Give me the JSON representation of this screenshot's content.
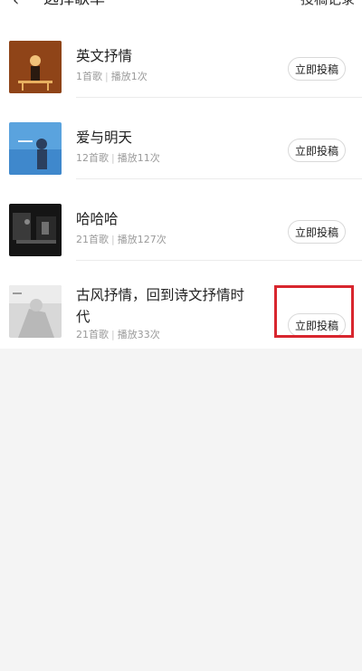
{
  "header": {
    "title": "选择歌单",
    "action_label": "投稿记录",
    "back_icon": "chevron-left-icon"
  },
  "playlists": [
    {
      "title": "英文抒情",
      "count": "1首歌",
      "plays": "播放1次",
      "button": "立即投稿"
    },
    {
      "title": "爱与明天",
      "count": "12首歌",
      "plays": "播放11次",
      "button": "立即投稿"
    },
    {
      "title": "哈哈哈",
      "count": "21首歌",
      "plays": "播放127次",
      "button": "立即投稿"
    },
    {
      "title": "古风抒情，回到诗文抒情时代",
      "count": "21首歌",
      "plays": "播放33次",
      "button": "立即投稿"
    }
  ],
  "colors": {
    "highlight": "#d8262e"
  }
}
